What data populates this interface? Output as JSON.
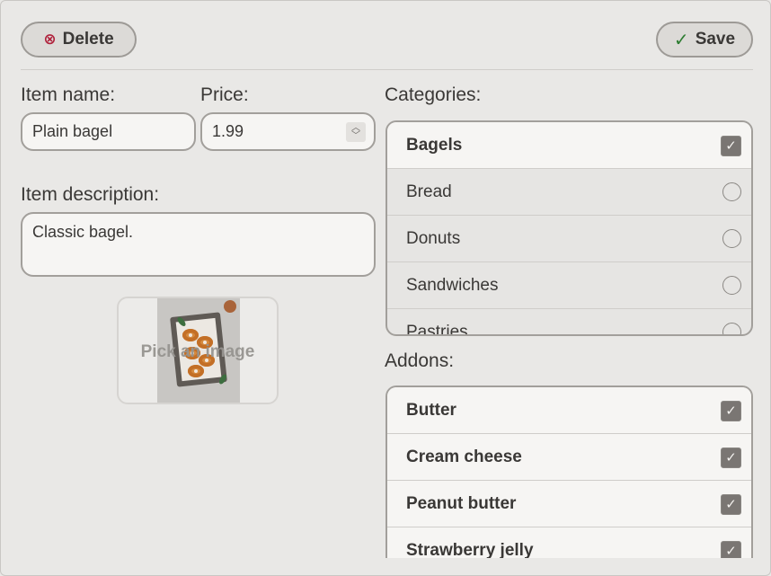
{
  "toolbar": {
    "delete_label": "Delete",
    "save_label": "Save"
  },
  "form": {
    "name_label": "Item name:",
    "name_value": "Plain bagel",
    "price_label": "Price:",
    "price_value": "1.99",
    "desc_label": "Item description:",
    "desc_value": "Classic bagel.",
    "image_label": "Pick an image"
  },
  "categories": {
    "label": "Categories:",
    "items": [
      {
        "label": "Bagels",
        "checked": true
      },
      {
        "label": "Bread",
        "checked": false
      },
      {
        "label": "Donuts",
        "checked": false
      },
      {
        "label": "Sandwiches",
        "checked": false
      },
      {
        "label": "Pastries",
        "checked": false
      }
    ]
  },
  "addons": {
    "label": "Addons:",
    "items": [
      {
        "label": "Butter",
        "checked": true
      },
      {
        "label": "Cream cheese",
        "checked": true
      },
      {
        "label": "Peanut butter",
        "checked": true
      },
      {
        "label": "Strawberry jelly",
        "checked": true
      }
    ]
  },
  "colors": {
    "delete_icon": "#b0223c",
    "save_icon": "#2e7d32",
    "checkbox_fill": "#7a7673"
  }
}
